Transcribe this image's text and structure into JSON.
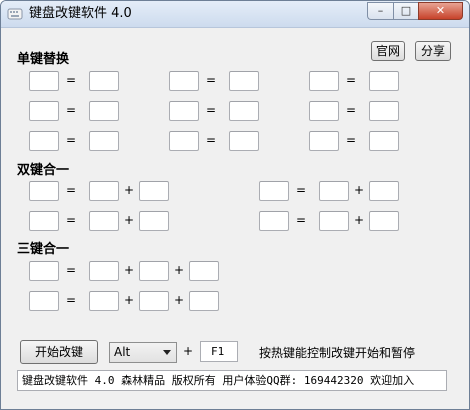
{
  "window": {
    "title": "键盘改键软件 4.0",
    "controls": {
      "minimize": "–",
      "maximize": "□",
      "close": "✕"
    }
  },
  "header_buttons": {
    "official_site": "官网",
    "share": "分享"
  },
  "sections": {
    "single": {
      "label": "单键替换"
    },
    "double": {
      "label": "双键合一"
    },
    "triple": {
      "label": "三键合一"
    }
  },
  "operators": {
    "equals": "=",
    "plus": "+"
  },
  "bottom": {
    "start_button": "开始改键",
    "modifier_select": {
      "value": "Alt"
    },
    "hotkey": {
      "value": "F1"
    },
    "hint": "按热键能控制改键开始和暂停"
  },
  "status_bar": {
    "text": "键盘改键软件 4.0 森林精品 版权所有 用户体验QQ群: 169442320 欢迎加入"
  }
}
